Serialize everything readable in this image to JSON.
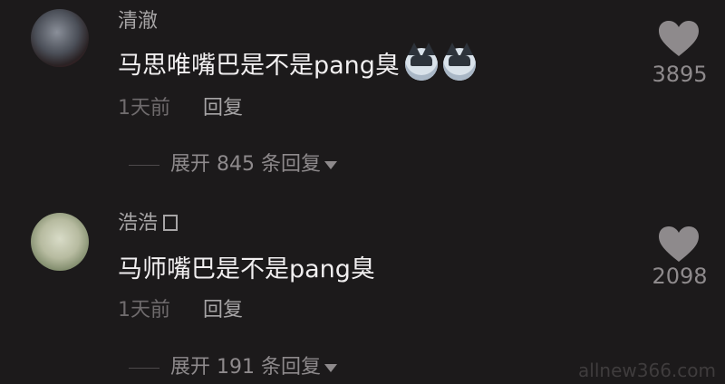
{
  "comments": [
    {
      "username": "清澈",
      "text": "马思唯嘴巴是不是pang臭",
      "time": "1天前",
      "reply_label": "回复",
      "expand_label": "展开 845 条回复",
      "likes": "3895",
      "emojis": [
        "husky-emoji-icon",
        "husky-emoji-icon"
      ]
    },
    {
      "username": "浩浩",
      "text": "马师嘴巴是不是pang臭",
      "time": "1天前",
      "reply_label": "回复",
      "expand_label": "展开 191 条回复",
      "likes": "2098"
    }
  ],
  "watermark": "allnew366.com",
  "colors": {
    "background": "#1c1a1b",
    "text": "#f1eff0",
    "muted": "#8e8a8c"
  }
}
